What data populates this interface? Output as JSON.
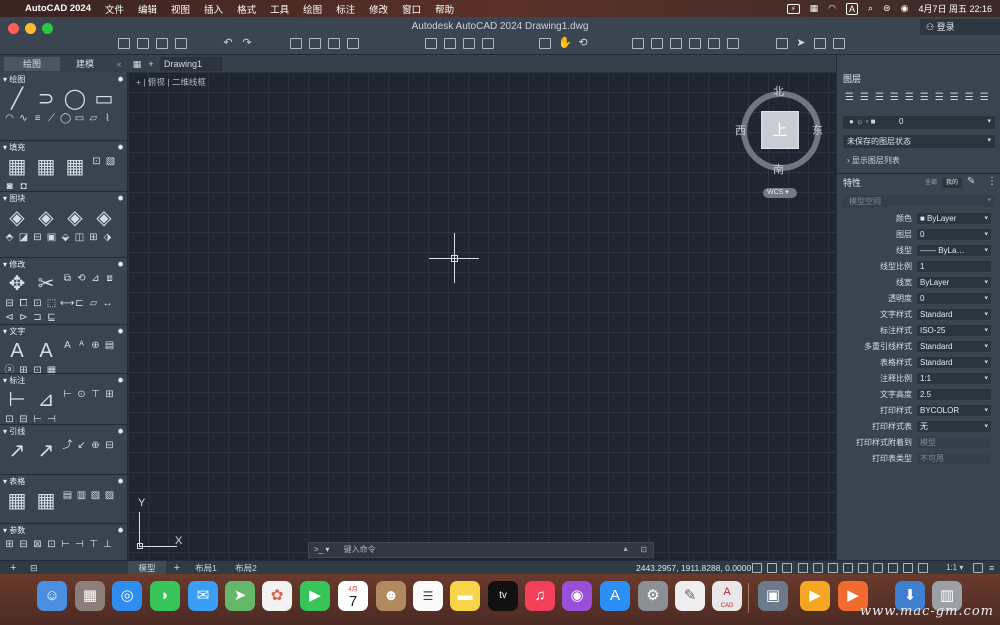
{
  "menubar": {
    "apple": "",
    "app": "AutoCAD 2024",
    "items": [
      "文件",
      "编辑",
      "视图",
      "插入",
      "格式",
      "工具",
      "绘图",
      "标注",
      "修改",
      "窗口",
      "帮助"
    ],
    "battery": "⚡",
    "input_badge": "A",
    "datetime": "4月7日 周五  22:16"
  },
  "titlebar": {
    "title": "Autodesk AutoCAD 2024   Drawing1.dwg",
    "login": "登录"
  },
  "tabs": {
    "left_tabs": [
      "绘图",
      "建模"
    ],
    "doc_tab": "Drawing1",
    "add": "+"
  },
  "left_palette": {
    "sections": [
      {
        "title": "绘图",
        "big": [
          "╱",
          "⊃",
          "◯",
          "▭"
        ],
        "small": [
          "◠",
          "∿",
          "≡",
          "⟋",
          "◯",
          "▭",
          "▱",
          "⌇"
        ]
      },
      {
        "title": "填充",
        "big": [
          "▦",
          "▦",
          "▦"
        ],
        "small": [
          "⊡",
          "▧",
          "◙",
          "◘"
        ]
      },
      {
        "title": "图块",
        "big": [
          "◈",
          "◈",
          "◈",
          "◈"
        ],
        "small": [
          "⬘",
          "◪",
          "⊟",
          "▣",
          "⬙",
          "◫",
          "⊞",
          "⬗"
        ]
      },
      {
        "title": "修改",
        "big": [
          "✥",
          "✂"
        ],
        "small": [
          "⧉",
          "⟲",
          "⊿",
          "⧈",
          "⊟",
          "⧠",
          "⊡",
          "⬚",
          "⟷",
          "⊏",
          "▱",
          "↔",
          "⊲",
          "⊳",
          "⊐",
          "⊑"
        ]
      },
      {
        "title": "文字",
        "big": [
          "A",
          "A"
        ],
        "small": [
          "A",
          "ᴬ",
          "⊕",
          "▤",
          "ⓐ",
          "⊞",
          "⊡",
          "▦"
        ]
      },
      {
        "title": "标注",
        "big": [
          "⊢",
          "⊿"
        ],
        "small": [
          "⊢",
          "⊙",
          "⊤",
          "⊞",
          "⊡",
          "⊟",
          "⊢",
          "⊣"
        ]
      },
      {
        "title": "引线",
        "big": [
          "↗",
          "↗"
        ],
        "small": [
          "⤴",
          "↙",
          "⊕",
          "⊟"
        ]
      },
      {
        "title": "表格",
        "big": [
          "▦",
          "▦"
        ],
        "small": [
          "▤",
          "▥",
          "▧",
          "▨"
        ]
      },
      {
        "title": "参数",
        "big": [],
        "small": [
          "⊞",
          "⊟",
          "⊠",
          "⊡",
          "⊢",
          "⊣",
          "⊤",
          "⊥"
        ]
      }
    ]
  },
  "canvas": {
    "view_label": "+ | 俯视 | 二维线框",
    "viewcube": {
      "top": "上",
      "north": "北",
      "south": "南",
      "east": "东",
      "west": "西",
      "wcs": "WCS ▾"
    },
    "ucs": {
      "x": "X",
      "y": "Y"
    },
    "command_placeholder": "键入命令",
    "command_prompt": ">_ ▾"
  },
  "right_palette": {
    "layers_title": "图层",
    "layer_current": "0",
    "layer_state": "未保存的图层状态",
    "layer_list": "显示图层列表",
    "props_title": "特性",
    "props_toggles": [
      "全部",
      "我的"
    ],
    "props_space": "模型空间",
    "properties": [
      {
        "label": "颜色",
        "value": "■ ByLayer",
        "dd": true,
        "disabled": false
      },
      {
        "label": "图层",
        "value": "0",
        "dd": true,
        "disabled": false
      },
      {
        "label": "线型",
        "value": "—— ByLa…",
        "dd": true,
        "disabled": false
      },
      {
        "label": "线型比例",
        "value": "1",
        "dd": false,
        "disabled": false
      },
      {
        "label": "线宽",
        "value": "ByLayer",
        "dd": true,
        "disabled": false
      },
      {
        "label": "透明度",
        "value": "0",
        "dd": true,
        "disabled": false
      },
      {
        "label": "文字样式",
        "value": "Standard",
        "dd": true,
        "disabled": false
      },
      {
        "label": "标注样式",
        "value": "ISO-25",
        "dd": true,
        "disabled": false
      },
      {
        "label": "多重引线样式",
        "value": "Standard",
        "dd": true,
        "disabled": false
      },
      {
        "label": "表格样式",
        "value": "Standard",
        "dd": true,
        "disabled": false
      },
      {
        "label": "注释比例",
        "value": "1:1",
        "dd": true,
        "disabled": false
      },
      {
        "label": "文字高度",
        "value": "2.5",
        "dd": false,
        "disabled": false
      },
      {
        "label": "打印样式",
        "value": "BYCOLOR",
        "dd": true,
        "disabled": false
      },
      {
        "label": "打印样式表",
        "value": "无",
        "dd": true,
        "disabled": false
      },
      {
        "label": "打印样式附着到",
        "value": "模型",
        "dd": false,
        "disabled": true
      },
      {
        "label": "打印表类型",
        "value": "不可用",
        "dd": false,
        "disabled": true
      }
    ]
  },
  "statusbar": {
    "tabs": [
      "模型",
      "布局1",
      "布局2"
    ],
    "add": "+",
    "coords": "2443.2957, 1911.8288, 0.0000",
    "scale": "1:1 ▾"
  },
  "dock": {
    "calendar_month": "4月",
    "calendar_day": "7",
    "tv_label": "tv",
    "cad_label": "CAD",
    "watermark": "www.mac-gm.com"
  },
  "colors": {
    "canvas_bg": "#1f2630",
    "panel_bg": "#3a4451",
    "titlebar_bg": "#3b4552"
  }
}
